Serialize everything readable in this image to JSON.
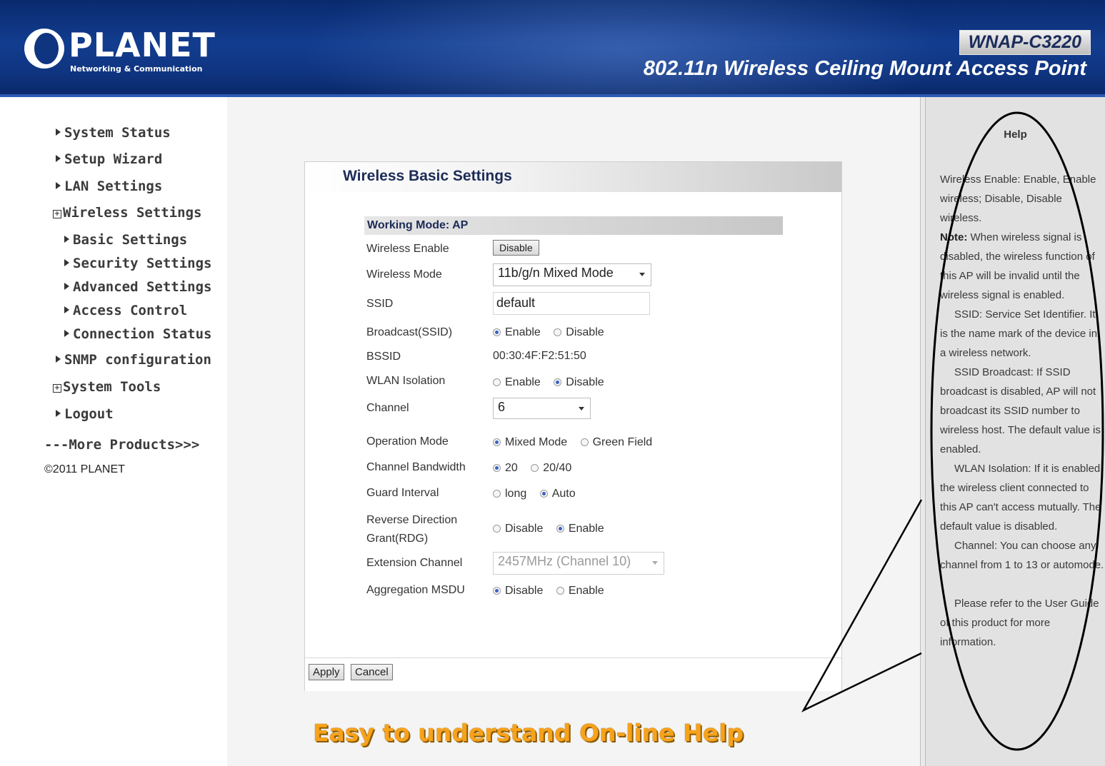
{
  "header": {
    "logo_name": "PLANET",
    "logo_tag": "Networking & Communication",
    "model": "WNAP-C3220",
    "product": "802.11n Wireless Ceiling Mount Access Point"
  },
  "nav": {
    "items": [
      {
        "label": "System Status",
        "marker": "arrow"
      },
      {
        "label": "Setup Wizard",
        "marker": "arrow"
      },
      {
        "label": "LAN Settings",
        "marker": "arrow"
      },
      {
        "label": "Wireless Settings",
        "marker": "plus"
      },
      {
        "label": "Basic Settings",
        "marker": "arrow"
      },
      {
        "label": "Security Settings",
        "marker": "arrow"
      },
      {
        "label": "Advanced Settings",
        "marker": "arrow"
      },
      {
        "label": "Access Control",
        "marker": "arrow"
      },
      {
        "label": "Connection Status",
        "marker": "arrow"
      },
      {
        "label": "SNMP configuration",
        "marker": "arrow"
      },
      {
        "label": "System Tools",
        "marker": "plus"
      },
      {
        "label": "Logout",
        "marker": "arrow"
      },
      {
        "label": "---More Products>>>",
        "marker": "none"
      }
    ],
    "copyright": "©2011 PLANET"
  },
  "panel": {
    "title": "Wireless Basic Settings",
    "working_mode": "Working Mode: AP",
    "fields": {
      "wireless_enable": {
        "label": "Wireless Enable",
        "button": "Disable"
      },
      "wireless_mode": {
        "label": "Wireless Mode",
        "value": "11b/g/n Mixed Mode"
      },
      "ssid": {
        "label": "SSID",
        "value": "default"
      },
      "broadcast": {
        "label": "Broadcast(SSID)",
        "options": [
          "Enable",
          "Disable"
        ],
        "selected": "Enable"
      },
      "bssid": {
        "label": "BSSID",
        "value": "00:30:4F:F2:51:50"
      },
      "wlan_isolation": {
        "label": "WLAN Isolation",
        "options": [
          "Enable",
          "Disable"
        ],
        "selected": "Disable"
      },
      "channel": {
        "label": "Channel",
        "value": "6"
      },
      "operation_mode": {
        "label": "Operation Mode",
        "options": [
          "Mixed Mode",
          "Green Field"
        ],
        "selected": "Mixed Mode"
      },
      "channel_bandwidth": {
        "label": "Channel Bandwidth",
        "options": [
          "20",
          "20/40"
        ],
        "selected": "20"
      },
      "guard_interval": {
        "label": "Guard Interval",
        "options": [
          "long",
          "Auto"
        ],
        "selected": "Auto"
      },
      "rdg": {
        "label_line1": "Reverse Direction",
        "label_line2": "Grant(RDG)",
        "options": [
          "Disable",
          "Enable"
        ],
        "selected": "Enable"
      },
      "extension_channel": {
        "label": "Extension Channel",
        "value": "2457MHz (Channel 10)"
      },
      "aggregation_msdu": {
        "label": "Aggregation MSDU",
        "options": [
          "Disable",
          "Enable"
        ],
        "selected": "Disable"
      }
    },
    "apply": "Apply",
    "cancel": "Cancel"
  },
  "callout": "Easy to understand On-line Help",
  "help": {
    "title": "Help",
    "p1_a": "Wireless Enable: Enable, Enable wireless; Disable, Disable wireless.",
    "p1_note_label": "Note:",
    "p1_note": " When wireless signal is disabled, the wireless function of this AP will be invalid until the wireless signal is enabled.",
    "p2": "SSID: Service Set Identifier. It is the name mark of the device in a wireless network.",
    "p3": "SSID Broadcast: If SSID broadcast is disabled, AP will not broadcast its SSID number to wireless host. The default value is enabled.",
    "p4": "WLAN Isolation: If it is enabled, the wireless client connected to this AP can't access mutually. The default value is disabled.",
    "p5": "Channel: You can choose any channel from 1 to 13 or automode.",
    "p6": "Please refer to the User Guide of this product for more information."
  },
  "colors": {
    "header_blue": "#0f3480",
    "title_navy": "#1c2c57",
    "callout_orange": "#f7a21b",
    "radio_blue": "#3a62c4"
  }
}
